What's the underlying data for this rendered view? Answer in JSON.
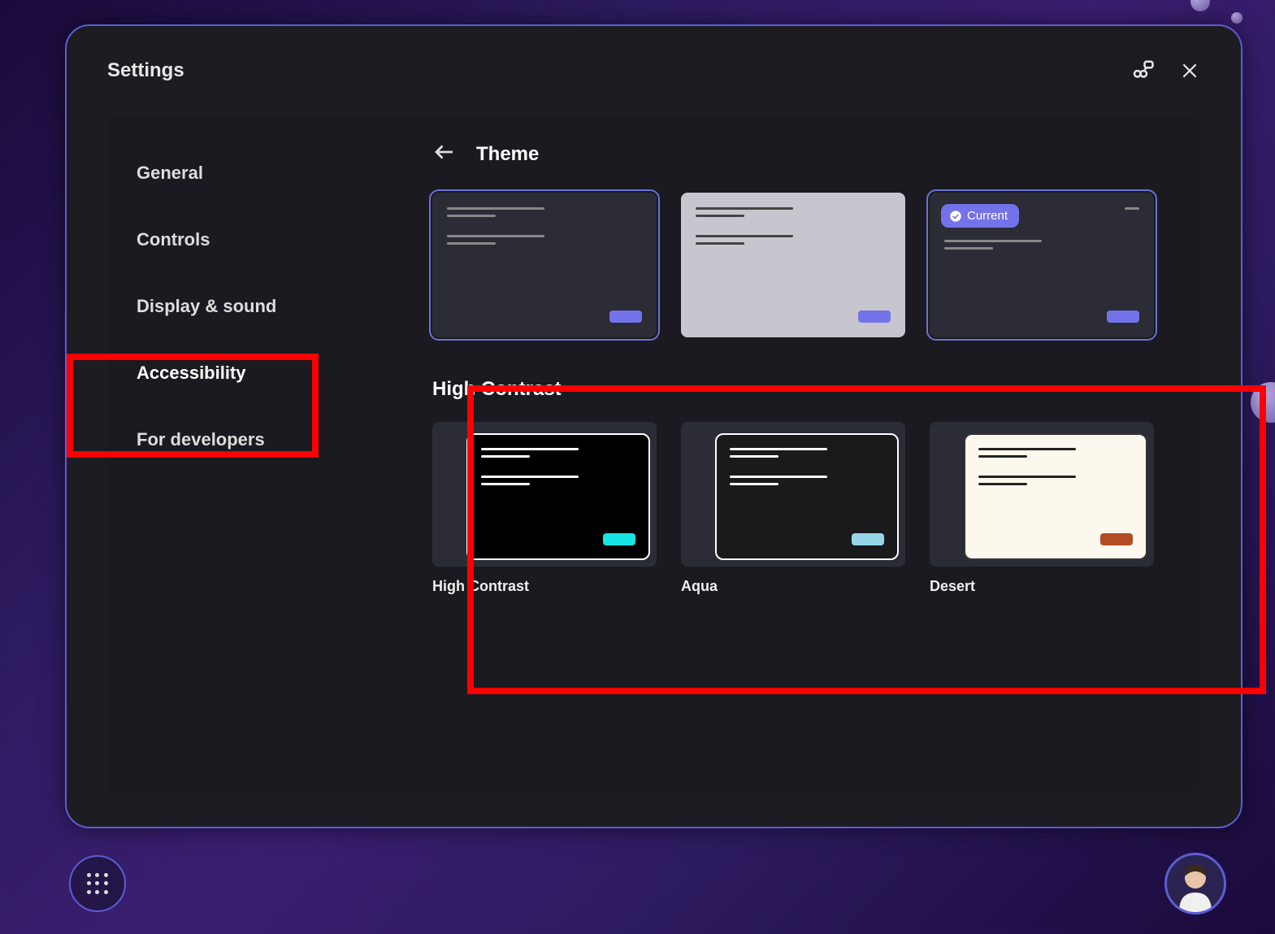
{
  "panel": {
    "title": "Settings"
  },
  "sidebar": {
    "items": [
      {
        "label": "General"
      },
      {
        "label": "Controls"
      },
      {
        "label": "Display & sound"
      },
      {
        "label": "Accessibility"
      },
      {
        "label": "For developers"
      }
    ]
  },
  "content": {
    "title": "Theme",
    "current_badge": "Current",
    "high_contrast_title": "High Contrast",
    "hc_themes": [
      {
        "label": "High Contrast"
      },
      {
        "label": "Aqua"
      },
      {
        "label": "Desert"
      }
    ]
  },
  "colors": {
    "accent": "#7472e8",
    "cyan": "#18e4e4",
    "aqua": "#97d5e7",
    "desert": "#b34b23"
  }
}
